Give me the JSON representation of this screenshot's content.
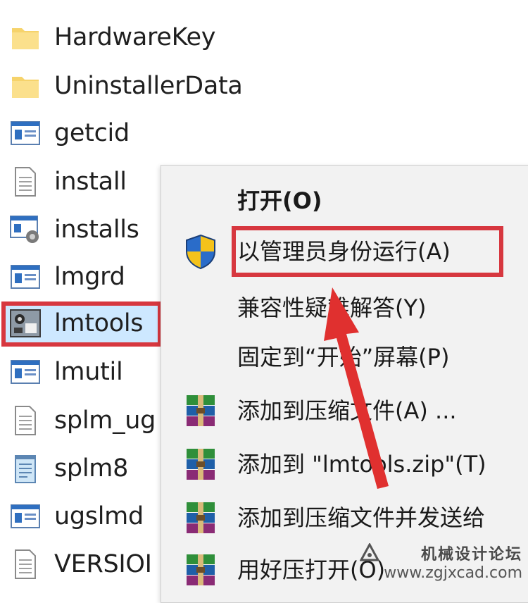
{
  "files": [
    {
      "name": "HardwareKey",
      "icon": "folder-icon"
    },
    {
      "name": "UninstallerData",
      "icon": "folder-icon"
    },
    {
      "name": "getcid",
      "icon": "application-icon"
    },
    {
      "name": "install",
      "icon": "document-icon"
    },
    {
      "name": "installs",
      "icon": "installer-icon"
    },
    {
      "name": "lmgrd",
      "icon": "application-icon"
    },
    {
      "name": "lmtools",
      "icon": "lmtools-app-icon",
      "selected": true
    },
    {
      "name": "lmutil",
      "icon": "application-icon"
    },
    {
      "name": "splm_ug",
      "icon": "document-icon"
    },
    {
      "name": "splm8",
      "icon": "notepad-icon"
    },
    {
      "name": "ugslmd",
      "icon": "application-icon"
    },
    {
      "name": "VERSIOI",
      "icon": "document-icon"
    }
  ],
  "context_menu": {
    "items": [
      {
        "label": "打开(O)",
        "icon": ""
      },
      {
        "label": "以管理员身份运行(A)",
        "icon": "uac-shield-icon"
      },
      {
        "label": "兼容性疑难解答(Y)",
        "icon": ""
      },
      {
        "label": "固定到“开始”屏幕(P)",
        "icon": ""
      },
      {
        "label": "添加到压缩文件(A) ...",
        "icon": "winrar-icon"
      },
      {
        "label": "添加到 \"lmtools.zip\"(T)",
        "icon": "winrar-icon"
      },
      {
        "label": "添加到压缩文件并发送给",
        "icon": "winrar-icon"
      },
      {
        "label": "用好压打开(O)",
        "icon": "winrar-icon"
      }
    ]
  },
  "watermark": {
    "text_cn": "机械设计论坛",
    "url": "www.zgjxcad.com"
  },
  "colors": {
    "highlight_red": "#d7373f",
    "selection_blue": "#cde8ff",
    "menu_bg": "#f2f2f2"
  }
}
